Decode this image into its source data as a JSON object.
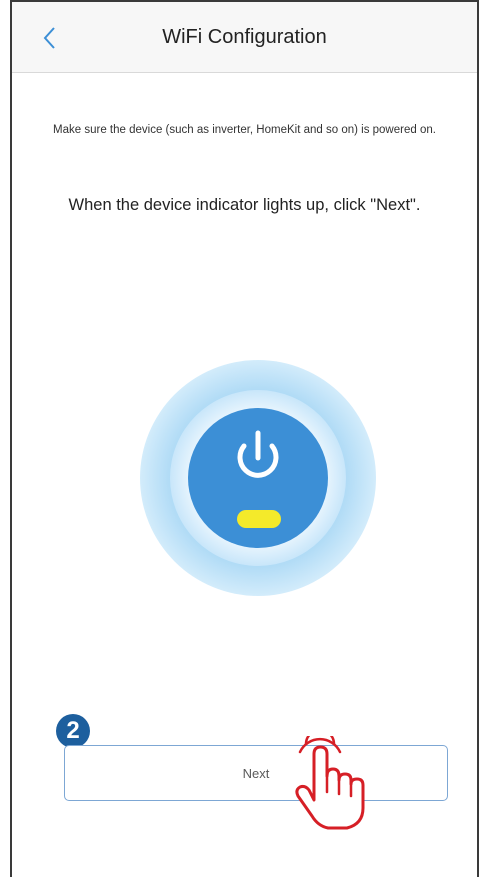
{
  "header": {
    "title": "WiFi Configuration",
    "back_icon": "chevron-left-icon"
  },
  "content": {
    "hint": "Make sure the device (such as inverter, HomeKit and so on) is powered on.",
    "instruction": "When the device indicator lights up, click \"Next\".",
    "power_icon": "power-icon",
    "indicator_color": "#f4ea2a"
  },
  "actions": {
    "step_number": "2",
    "next_label": "Next",
    "pointer_icon": "hand-pointer-icon"
  },
  "colors": {
    "accent": "#3c8fd6",
    "badge": "#1d5f9e",
    "pointer": "#d61f26"
  }
}
